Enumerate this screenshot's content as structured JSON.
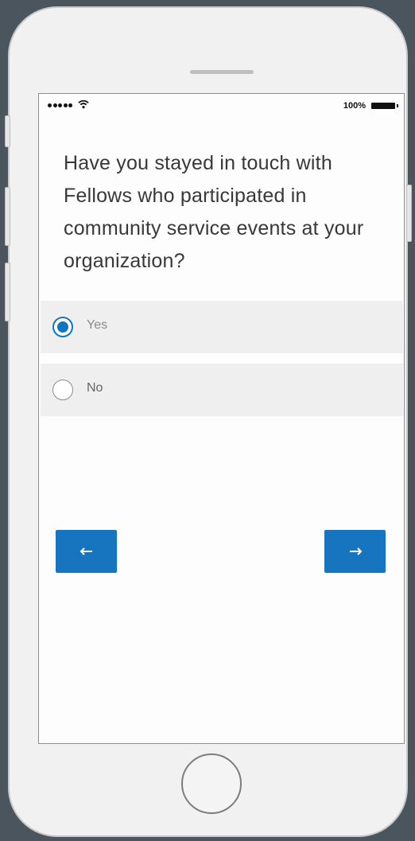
{
  "status_bar": {
    "battery_text": "100%",
    "signal_icon": "signal-dots-icon",
    "wifi_icon": "wifi-icon",
    "battery_icon": "battery-icon"
  },
  "survey": {
    "question": "Have you stayed in touch with Fellows who participated in community service events at your organization?",
    "options": [
      {
        "label": "Yes",
        "selected": true
      },
      {
        "label": "No",
        "selected": false
      }
    ]
  },
  "navigation": {
    "back_icon": "arrow-left-icon",
    "next_icon": "arrow-right-icon"
  },
  "colors": {
    "accent": "#1775c0",
    "option_bg": "#efefef",
    "question_text": "#383838"
  }
}
